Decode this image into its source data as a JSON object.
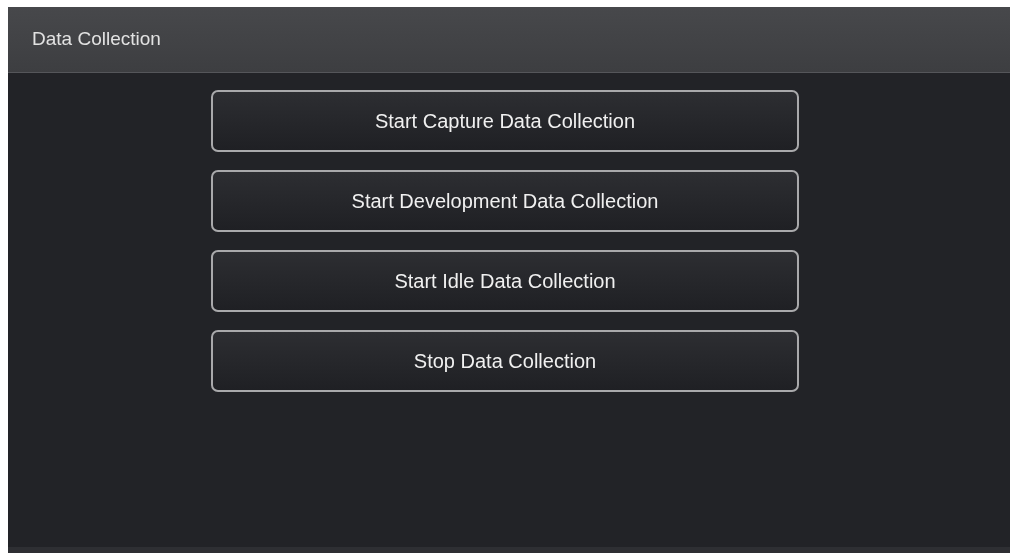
{
  "panel": {
    "title": "Data Collection"
  },
  "buttons": [
    {
      "label": "Start Capture Data Collection"
    },
    {
      "label": "Start Development Data Collection"
    },
    {
      "label": "Start Idle Data Collection"
    },
    {
      "label": "Stop Data Collection"
    }
  ]
}
